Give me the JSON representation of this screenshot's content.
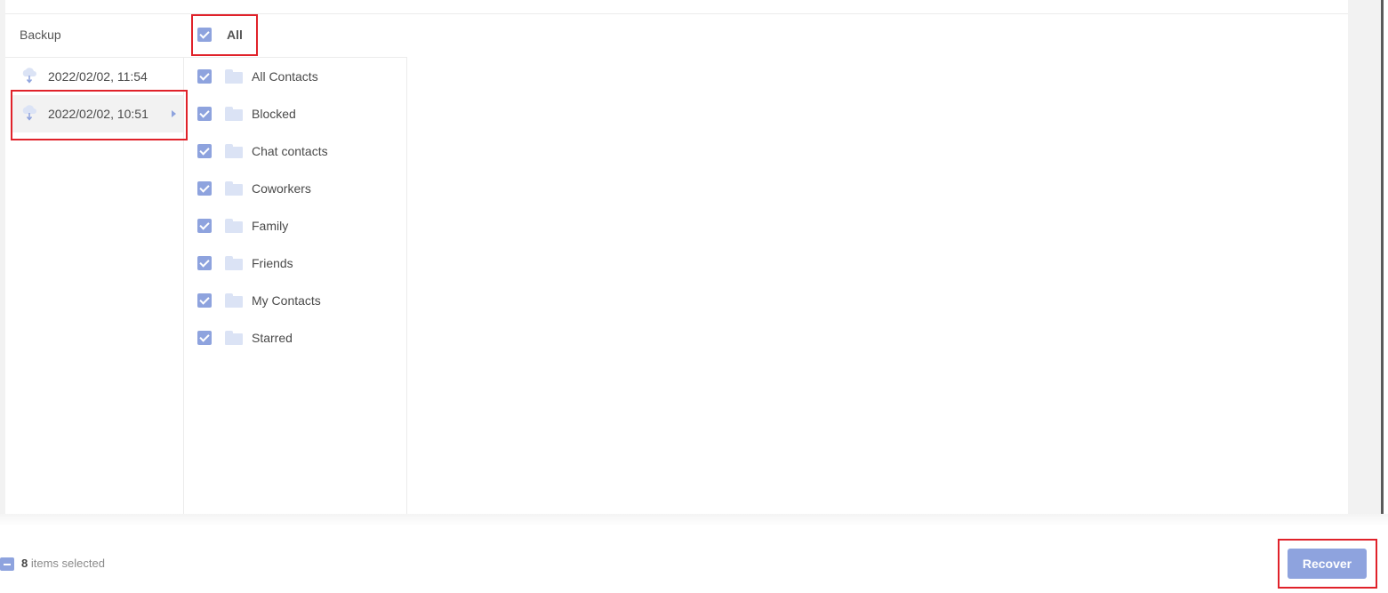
{
  "backup": {
    "header": "Backup",
    "items": [
      {
        "label": "2022/02/02, 11:54",
        "icon": "cloud-download-icon",
        "selected": false
      },
      {
        "label": "2022/02/02, 10:51",
        "icon": "cloud-download-icon",
        "selected": true
      }
    ]
  },
  "categories": {
    "all_label": "All",
    "all_checked": true,
    "items": [
      {
        "label": "All Contacts",
        "checked": true,
        "icon": "folder-icon"
      },
      {
        "label": "Blocked",
        "checked": true,
        "icon": "folder-icon"
      },
      {
        "label": "Chat contacts",
        "checked": true,
        "icon": "folder-icon"
      },
      {
        "label": "Coworkers",
        "checked": true,
        "icon": "folder-icon"
      },
      {
        "label": "Family",
        "checked": true,
        "icon": "folder-icon"
      },
      {
        "label": "Friends",
        "checked": true,
        "icon": "folder-icon"
      },
      {
        "label": "My Contacts",
        "checked": true,
        "icon": "folder-icon"
      },
      {
        "label": "Starred",
        "checked": true,
        "icon": "folder-icon"
      }
    ]
  },
  "footer": {
    "selected_count": "8",
    "selected_suffix": " items selected",
    "recover_label": "Recover"
  },
  "colors": {
    "accent": "#8ea3de",
    "highlight": "#e0222a",
    "folder": "#dbe3f5"
  }
}
